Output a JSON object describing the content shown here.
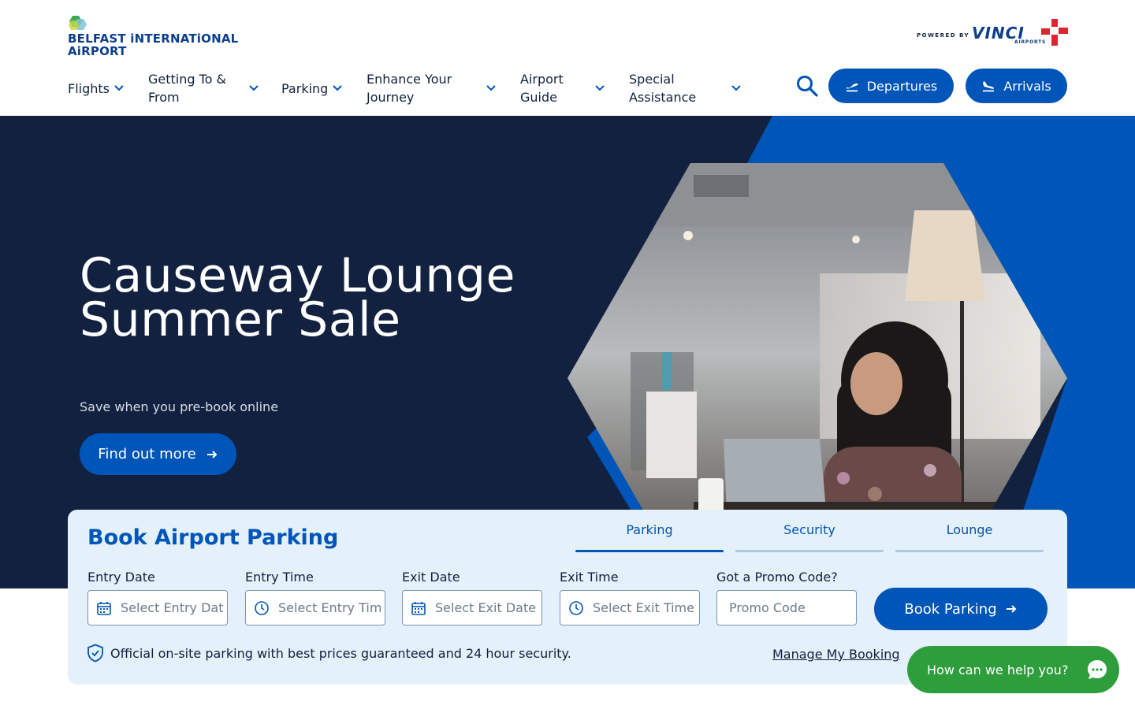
{
  "brand": {
    "logo_line1": "BELFAST iNTERNATiONAL",
    "logo_line2": "AiRPORT",
    "powered_by": "POWERED BY",
    "vinci": "VINCI",
    "vinci_sub": "AIRPORTS"
  },
  "nav": {
    "items": [
      {
        "label": "Flights"
      },
      {
        "label": "Getting To & From"
      },
      {
        "label": "Parking"
      },
      {
        "label": "Enhance Your Journey"
      },
      {
        "label": "Airport Guide"
      },
      {
        "label": "Special Assistance"
      }
    ],
    "departures_label": "Departures",
    "arrivals_label": "Arrivals"
  },
  "hero": {
    "title": "Causeway Lounge Summer Sale",
    "subtitle": "Save when you pre-book online",
    "cta_label": "Find out more"
  },
  "booking": {
    "title": "Book Airport Parking",
    "tabs": [
      {
        "label": "Parking",
        "active": true
      },
      {
        "label": "Security",
        "active": false
      },
      {
        "label": "Lounge",
        "active": false
      }
    ],
    "fields": [
      {
        "label": "Entry Date",
        "placeholder": "Select Entry Date",
        "icon": "calendar-icon"
      },
      {
        "label": "Entry Time",
        "placeholder": "Select Entry Time",
        "icon": "clock-icon"
      },
      {
        "label": "Exit Date",
        "placeholder": "Select Exit Date",
        "icon": "calendar-icon"
      },
      {
        "label": "Exit Time",
        "placeholder": "Select Exit Time",
        "icon": "clock-icon"
      },
      {
        "label": "Got a Promo Code?",
        "placeholder": "Promo Code",
        "icon": ""
      }
    ],
    "submit_label": "Book Parking",
    "note": "Official on-site parking with best prices guaranteed and 24 hour security.",
    "manage_label": "Manage My Booking"
  },
  "chat": {
    "label": "How can we help you?"
  },
  "colors": {
    "primary": "#0055b8",
    "navy": "#12213f",
    "panel": "#e4f0fa",
    "chat": "#2e9e3d"
  }
}
